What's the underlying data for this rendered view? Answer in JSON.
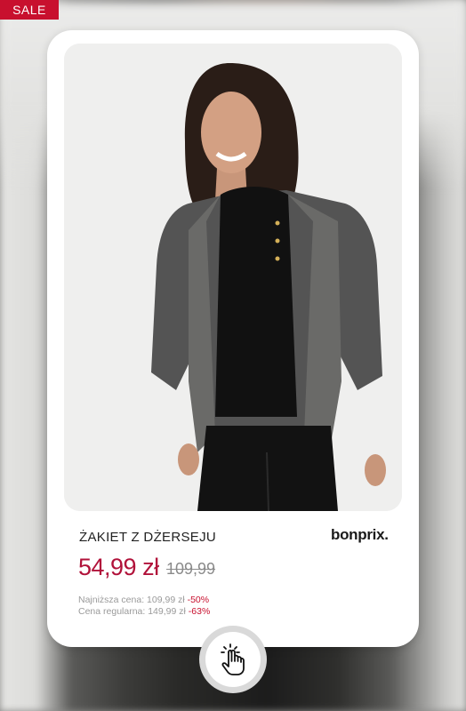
{
  "badge": {
    "label": "SALE"
  },
  "product": {
    "name": "ŻAKIET Z DŻERSEJU",
    "price": "54,99 zł",
    "old_price": "109,99"
  },
  "brand": {
    "logo": "bonprix."
  },
  "price_info": {
    "lowest_label": "Najniższa cena: 109,99 zł",
    "lowest_discount": "-50%",
    "regular_label": "Cena regularna: 149,99 zł",
    "regular_discount": "-63%"
  },
  "icons": {
    "tap": "hand-tap-icon"
  },
  "colors": {
    "accent": "#b1123a",
    "badge": "#c8102e"
  }
}
